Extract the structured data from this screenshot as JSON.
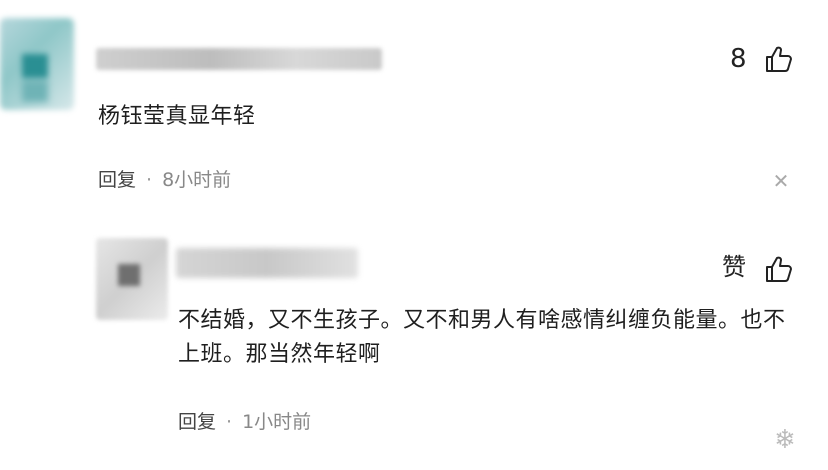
{
  "comment": {
    "like_count": "8",
    "text": "杨钰莹真显年轻",
    "reply_label": "回复",
    "separator": "·",
    "time": "8小时前",
    "close_icon": "close-icon"
  },
  "reply": {
    "like_label": "赞",
    "text": "不结婚，又不生孩子。又不和男人有啥感情纠缠负能量。也不上班。那当然年轻啊",
    "reply_label": "回复",
    "separator": "·",
    "time": "1小时前"
  },
  "colors": {
    "text": "#1f1f1f",
    "meta_time": "#888888",
    "avatar_accent": "#2a8f93"
  }
}
